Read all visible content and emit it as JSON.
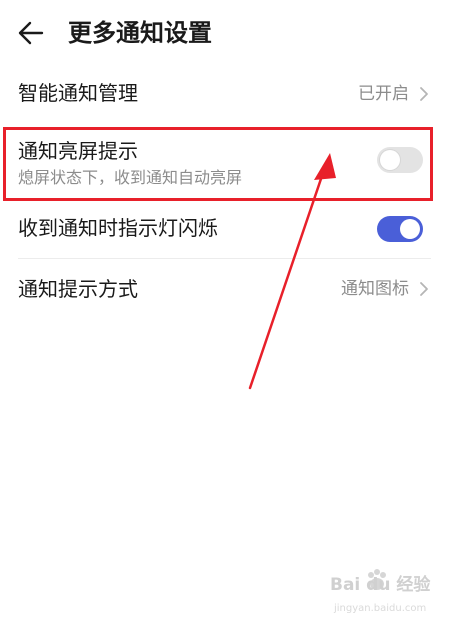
{
  "header": {
    "title": "更多通知设置",
    "back_icon": "arrow-left-icon"
  },
  "settings": {
    "smart_notification": {
      "label": "智能通知管理",
      "value": "已开启"
    },
    "wake_screen": {
      "label": "通知亮屏提示",
      "description": "熄屏状态下，收到通知自动亮屏",
      "enabled": false
    },
    "indicator_light": {
      "label": "收到通知时指示灯闪烁",
      "enabled": true
    },
    "notify_style": {
      "label": "通知提示方式",
      "value": "通知图标"
    }
  },
  "annotation": {
    "highlight_color": "#e8202a"
  },
  "watermark": {
    "main": "Bai du 经验",
    "sub": "jingyan.baidu.com"
  },
  "colors": {
    "toggle_on": "#4a5fd8",
    "toggle_off": "#e3e3e3",
    "secondary_text": "#8c8c8c"
  }
}
